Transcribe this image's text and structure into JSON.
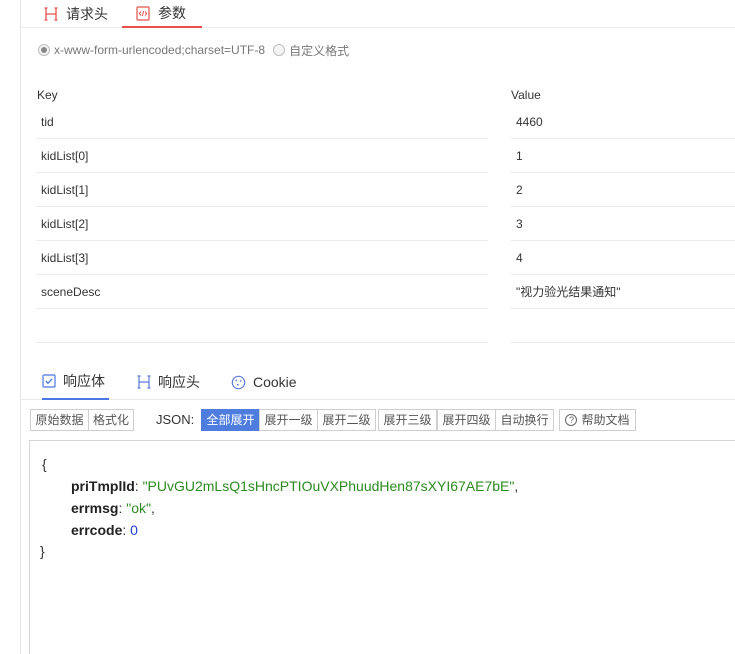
{
  "request_tabs": [
    {
      "label": "请求头",
      "icon": "header-h-icon"
    },
    {
      "label": "参数",
      "icon": "code-doc-icon"
    }
  ],
  "content_type": {
    "options": [
      {
        "label": "x-www-form-urlencoded;charset=UTF-8",
        "selected": true
      },
      {
        "label": "自定义格式",
        "selected": false
      }
    ]
  },
  "params": {
    "key_header": "Key",
    "value_header": "Value",
    "rows": [
      {
        "key": "tid",
        "value": "4460"
      },
      {
        "key": "kidList[0]",
        "value": "1"
      },
      {
        "key": "kidList[1]",
        "value": "2"
      },
      {
        "key": "kidList[2]",
        "value": "3"
      },
      {
        "key": "kidList[3]",
        "value": "4"
      },
      {
        "key": "sceneDesc",
        "value": "\"视力验光结果通知\""
      },
      {
        "key": "",
        "value": ""
      }
    ]
  },
  "response_tabs": [
    {
      "label": "响应体",
      "icon": "checkbox-icon"
    },
    {
      "label": "响应头",
      "icon": "header-h-icon"
    },
    {
      "label": "Cookie",
      "icon": "cookie-icon"
    }
  ],
  "toolbar": {
    "raw": "原始数据",
    "format": "格式化",
    "json_label": "JSON:",
    "expand_all": "全部展开",
    "expand_1": "展开一级",
    "expand_2": "展开二级",
    "expand_3": "展开三级",
    "expand_4": "展开四级",
    "auto_wrap": "自动换行",
    "help": "帮助文档"
  },
  "response_json": {
    "open_brace": "{",
    "close_brace": "}",
    "fields": [
      {
        "key": "priTmplId",
        "value": "\"PUvGU2mLsQ1sHncPTIOuVXPhuudHen87sXYI67AE7bE\"",
        "type": "string"
      },
      {
        "key": "errmsg",
        "value": "\"ok\"",
        "type": "string"
      },
      {
        "key": "errcode",
        "value": "0",
        "type": "number"
      }
    ]
  },
  "colors": {
    "active_tab_red": "#e8504b",
    "active_tab_blue": "#4a78e4",
    "json_string": "#2a8b1e",
    "json_number": "#1f3fd1"
  }
}
